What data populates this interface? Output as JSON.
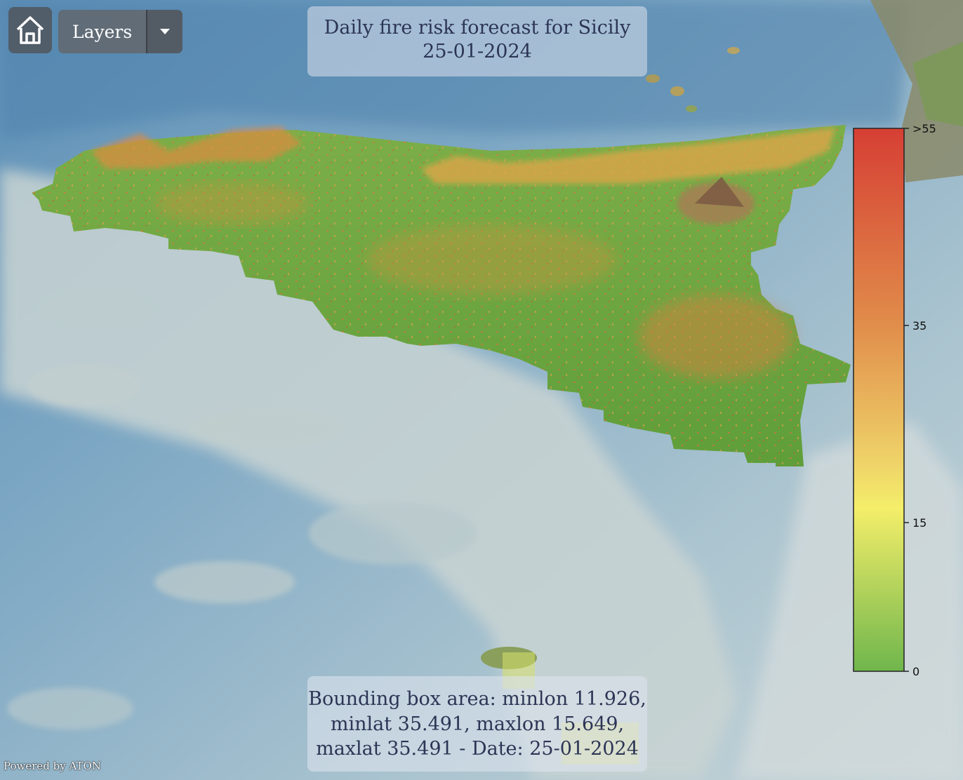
{
  "toolbar": {
    "home_icon": "home-icon",
    "layers_label": "Layers",
    "layers_caret_icon": "chevron-down-icon"
  },
  "title": {
    "line1": "Daily fire risk forecast for Sicily",
    "line2": "25-01-2024"
  },
  "info": {
    "line1": "Bounding box area: minlon 11.926,",
    "line2": "minlat 35.491, maxlon 15.649,",
    "line3": "maxlat 35.491 - Date: 25-01-2024"
  },
  "attribution": "Powered by ATON",
  "legend": {
    "labels": [
      ">55",
      "35",
      "15",
      "0"
    ],
    "colors": [
      "#d63f34",
      "#e08a4a",
      "#f4ee6a",
      "#6fb64c"
    ]
  },
  "colors": {
    "sea_deep": "#5f8fb8",
    "sea_shallow": "#b9cdd4",
    "land_risk_low": "#6aab3e"
  }
}
